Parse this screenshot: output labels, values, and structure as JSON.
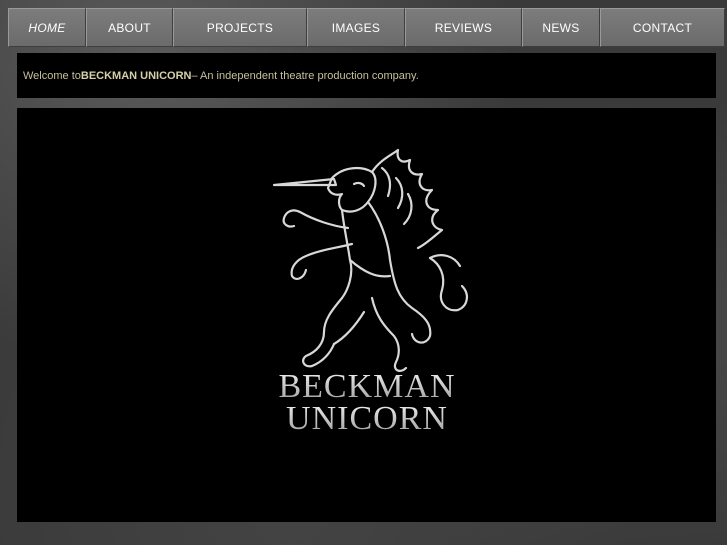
{
  "nav": {
    "items": [
      {
        "label": "HOME",
        "active": true
      },
      {
        "label": "ABOUT",
        "active": false
      },
      {
        "label": "PROJECTS",
        "active": false
      },
      {
        "label": "IMAGES",
        "active": false
      },
      {
        "label": "REVIEWS",
        "active": false
      },
      {
        "label": "NEWS",
        "active": false
      },
      {
        "label": "CONTACT",
        "active": false
      }
    ]
  },
  "welcome": {
    "prefix": "Welcome to ",
    "company": "BECKMAN UNICORN",
    "suffix": " – An independent theatre production company."
  },
  "hero": {
    "logo_icon": "unicorn-rampant-icon",
    "brand_line1": "BECKMAN",
    "brand_line2": "UNICORN"
  },
  "colors": {
    "nav_bg": "#737373",
    "panel_bg": "#000000",
    "welcome_text": "#c6c09a"
  }
}
